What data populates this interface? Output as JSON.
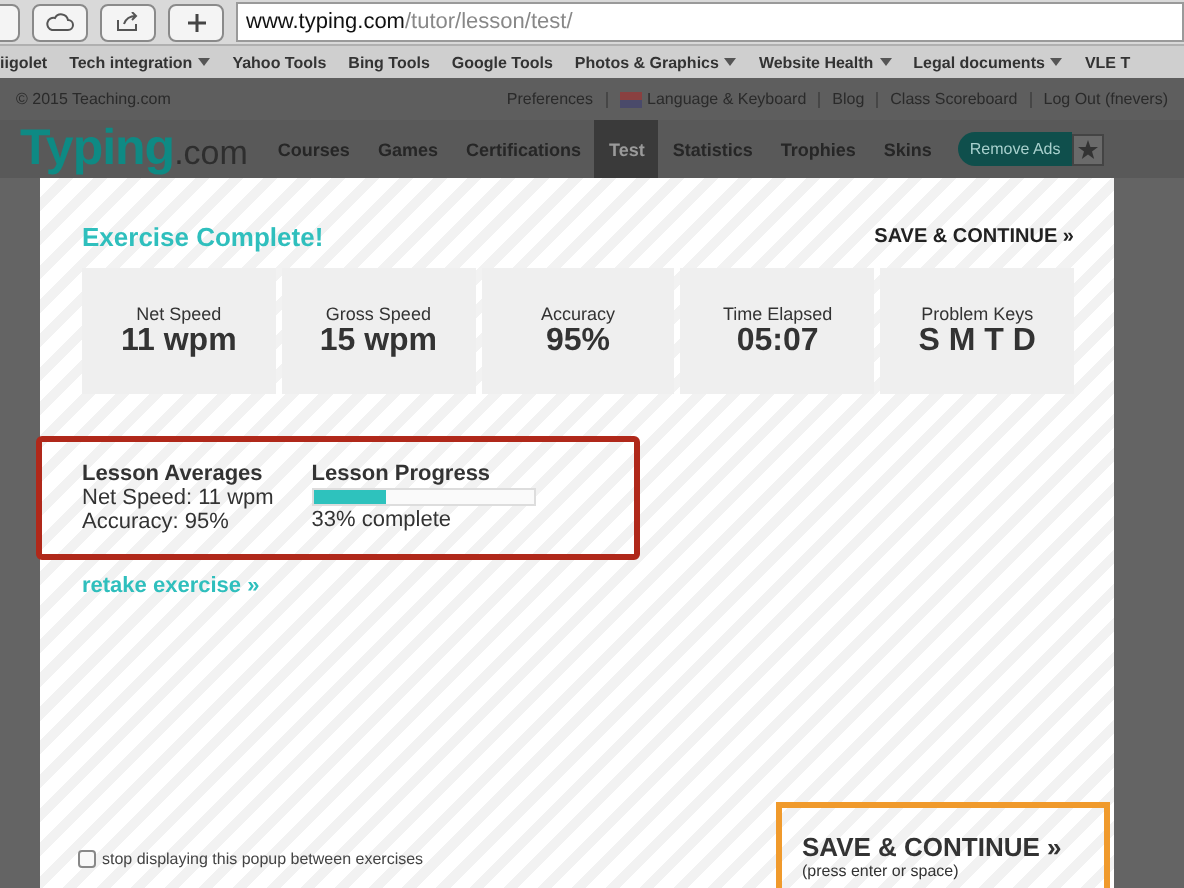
{
  "browser": {
    "url_host": "www.typing.com",
    "url_path": "/tutor/lesson/test/",
    "bookmarks": [
      {
        "label": "iigolet",
        "dropdown": false
      },
      {
        "label": "Tech integration",
        "dropdown": true
      },
      {
        "label": "Yahoo Tools",
        "dropdown": false
      },
      {
        "label": "Bing Tools",
        "dropdown": false
      },
      {
        "label": "Google Tools",
        "dropdown": false
      },
      {
        "label": "Photos & Graphics",
        "dropdown": true
      },
      {
        "label": "Website Health",
        "dropdown": true
      },
      {
        "label": "Legal documents",
        "dropdown": true
      },
      {
        "label": "VLE T",
        "dropdown": false
      }
    ]
  },
  "site": {
    "copyright": "© 2015 Teaching.com",
    "top_links": [
      {
        "label": "Preferences",
        "flag": false
      },
      {
        "label": "Language & Keyboard",
        "flag": true
      },
      {
        "label": "Blog",
        "flag": false
      },
      {
        "label": "Class Scoreboard",
        "flag": false
      },
      {
        "label": "Log Out (fnevers)",
        "flag": false
      }
    ],
    "logo": {
      "name": "Typing",
      "suffix": ".com"
    },
    "nav": [
      {
        "label": "Courses",
        "selected": false
      },
      {
        "label": "Games",
        "selected": false
      },
      {
        "label": "Certifications",
        "selected": false
      },
      {
        "label": "Test",
        "selected": true
      },
      {
        "label": "Statistics",
        "selected": false
      },
      {
        "label": "Trophies",
        "selected": false
      },
      {
        "label": "Skins",
        "selected": false
      }
    ],
    "remove_ads": "Remove Ads"
  },
  "modal": {
    "heading": "Exercise Complete!",
    "top_link": "SAVE & CONTINUE »",
    "stats": [
      {
        "label": "Net Speed",
        "value": "11 wpm"
      },
      {
        "label": "Gross Speed",
        "value": "15 wpm"
      },
      {
        "label": "Accuracy",
        "value": "95%"
      },
      {
        "label": "Time Elapsed",
        "value": "05:07"
      },
      {
        "label": "Problem Keys",
        "value": "S M T D"
      }
    ],
    "averages": {
      "title": "Lesson Averages",
      "lines": [
        "Net Speed: 11 wpm",
        "Accuracy: 95%"
      ]
    },
    "progress": {
      "title": "Lesson Progress",
      "level": 0.33,
      "reading": "33% complete"
    },
    "retake": "retake exercise »",
    "stop_popup": {
      "label": "stop displaying this popup between exercises",
      "checked": false
    },
    "save": {
      "label": "SAVE & CONTINUE »",
      "hint": "(press enter or space)"
    }
  }
}
